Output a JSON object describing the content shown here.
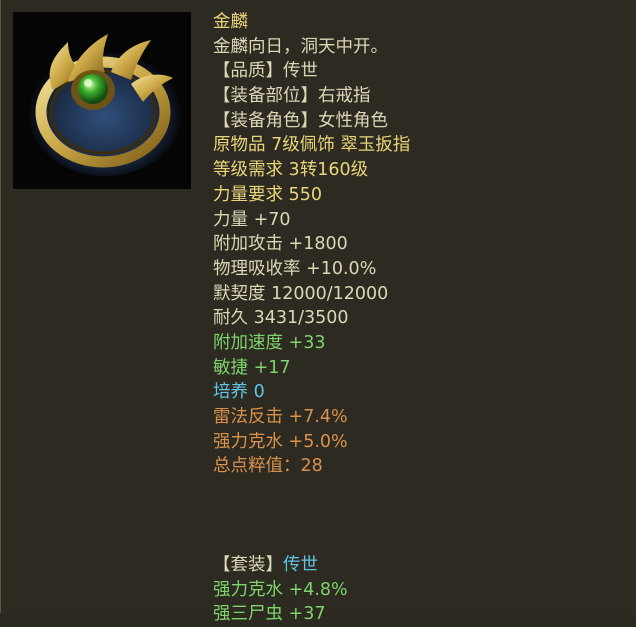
{
  "item": {
    "name": "金麟",
    "flavor": "金麟向日，洞天中开。",
    "icon": "jade-ring-icon"
  },
  "lines": [
    {
      "text": "【品质】传世",
      "color": "cream"
    },
    {
      "text": "【装备部位】右戒指",
      "color": "cream"
    },
    {
      "text": "【装备角色】女性角色",
      "color": "cream"
    },
    {
      "text": "原物品 7级佩饰 翠玉扳指",
      "color": "gold"
    },
    {
      "text": "等级需求 3转160级",
      "color": "gold"
    },
    {
      "text": "力量要求 550",
      "color": "gold"
    },
    {
      "text": "力量 +70",
      "color": "cream"
    },
    {
      "text": "附加攻击 +1800",
      "color": "cream"
    },
    {
      "text": "物理吸收率 +10.0%",
      "color": "cream"
    },
    {
      "text": "默契度 12000/12000",
      "color": "cream"
    },
    {
      "text": "耐久 3431/3500",
      "color": "cream"
    },
    {
      "text": "附加速度 +33",
      "color": "green"
    },
    {
      "text": "敏捷 +17",
      "color": "green"
    },
    {
      "text": "培养 0",
      "color": "blue"
    },
    {
      "text": "雷法反击 +7.4%",
      "color": "orange"
    },
    {
      "text": "强力克水 +5.0%",
      "color": "orange"
    },
    {
      "text": "总点粹值：28",
      "color": "orange"
    }
  ],
  "set": {
    "label": "【套装】",
    "name": "传世",
    "bonuses": [
      {
        "text": "强力克水 +4.8%",
        "color": "green"
      },
      {
        "text": "强三尸虫 +37",
        "color": "green"
      }
    ]
  },
  "colors": {
    "gold": "#e8d57a",
    "cream": "#dcd6b6",
    "green": "#7ed36c",
    "blue": "#5fc6e6",
    "orange": "#d9914b",
    "background": "#2d2a21"
  }
}
